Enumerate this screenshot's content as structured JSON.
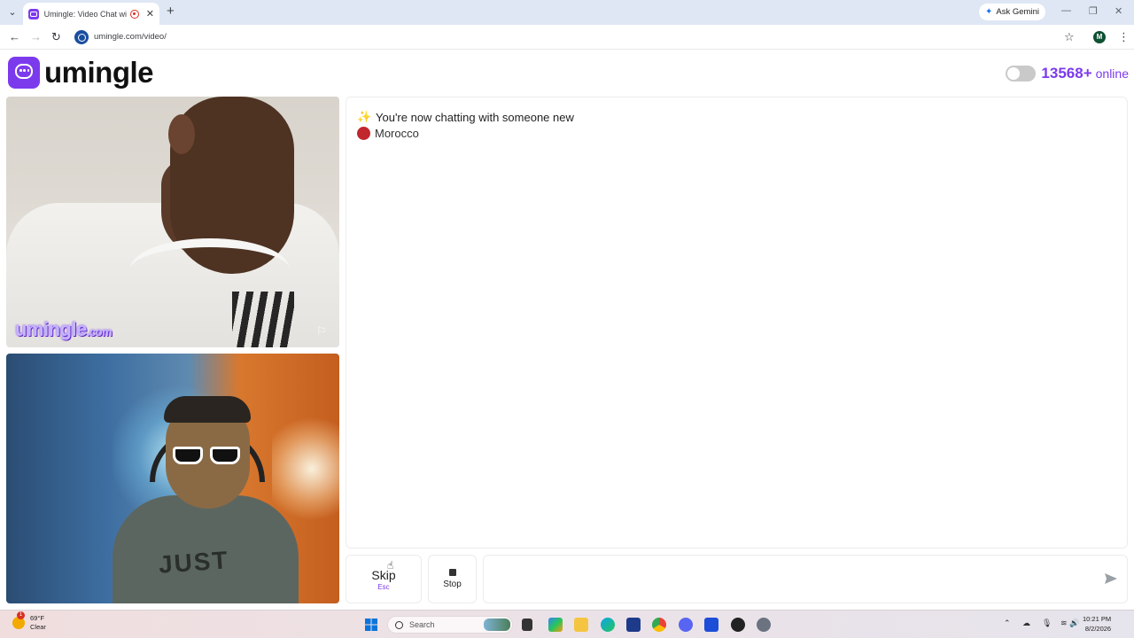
{
  "browser": {
    "tab_title": "Umingle: Video Chat with S",
    "new_tab": "+",
    "gemini_label": "Ask Gemini",
    "url": "umingle.com/video/",
    "profile_initial": "M",
    "window_controls": [
      "—",
      "❐",
      "✕"
    ]
  },
  "header": {
    "logo_text": "umingle",
    "online_count": "13568+",
    "online_label": "online"
  },
  "remote_video": {
    "watermark": "umingle",
    "watermark_suffix": ".com"
  },
  "local_video": {
    "shirt_text": "JUST"
  },
  "chat": {
    "messages": [
      {
        "icon": "sparkle-icon",
        "text": "You're now chatting with someone new"
      }
    ],
    "country": "Morocco",
    "country_color": "#c1272d"
  },
  "controls": {
    "skip_label": "Skip",
    "skip_key": "Esc",
    "stop_label": "Stop",
    "message_placeholder": ""
  },
  "taskbar": {
    "weather_temp": "69°F",
    "weather_desc": "Clear",
    "search_placeholder": "Search",
    "time": "10:21 PM",
    "date": "8/2/2026"
  },
  "colors": {
    "brand": "#7c3aed"
  }
}
